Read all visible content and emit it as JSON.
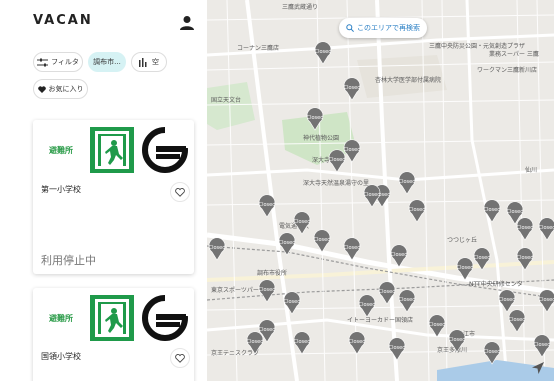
{
  "app": {
    "logo": "VACAN"
  },
  "filters": {
    "filter_label": "フィルタ",
    "area_label": "調布市...",
    "vacancy_label": "空",
    "favorites_label": "お気に入り"
  },
  "cards": [
    {
      "badge": "避難所",
      "name": "第一小学校",
      "status": "利用停止中"
    },
    {
      "badge": "避難所",
      "name": "国領小学校",
      "status": ""
    }
  ],
  "map": {
    "search_area_label": "このエリアで再検索",
    "pin_label": "Closed",
    "places": [
      "三鷹武蔵通り",
      "コーナン三鷹店",
      "三鷹中央防災公園・元気創造プラザ",
      "業務スーパー 三鷹",
      "杏林大学医学部付属病院",
      "ワークマン三鷹新川店",
      "国立天文台",
      "神代植物公園",
      "深大寺",
      "深大寺天然温泉湯守の里",
      "電気通信大",
      "調布市役所",
      "つつじヶ丘",
      "仙川",
      "東京スポーツパーク",
      "イトーヨーカドー国領店",
      "NTT中央研修センタ",
      "狛江市",
      "京王テニスクラブ",
      "京王多摩川"
    ]
  }
}
